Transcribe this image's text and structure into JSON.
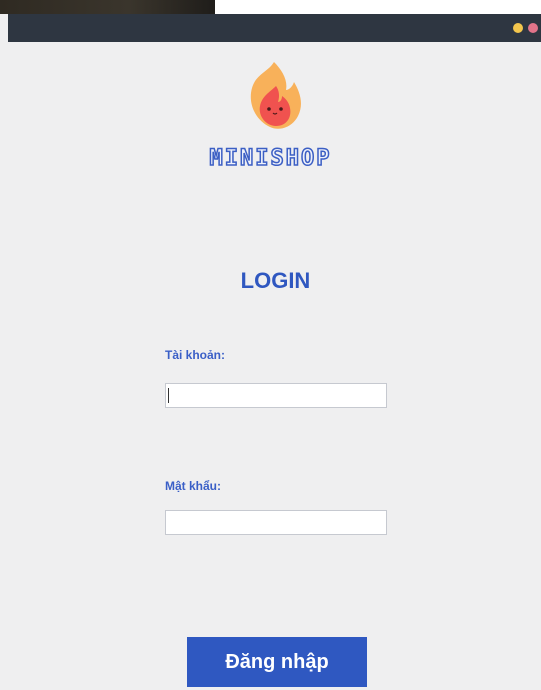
{
  "window": {
    "controls": [
      "minimize-dot",
      "close-dot"
    ],
    "control_colors": {
      "minimize": "#f3c64d",
      "close": "#e2748a"
    }
  },
  "brand": {
    "name": "MINISHOP",
    "logo_icon": "flame-mascot-icon",
    "logo_colors": {
      "outer_flame": "#f8b15a",
      "inner_flame": "#f0524f"
    }
  },
  "login": {
    "heading": "LOGIN",
    "username_label": "Tài khoản:",
    "username_value": "",
    "password_label": "Mật khẩu:",
    "password_value": "",
    "submit_label": "Đăng nhập"
  },
  "colors": {
    "accent": "#2f58c1",
    "titlebar": "#2e3641",
    "background": "#efeff0"
  }
}
